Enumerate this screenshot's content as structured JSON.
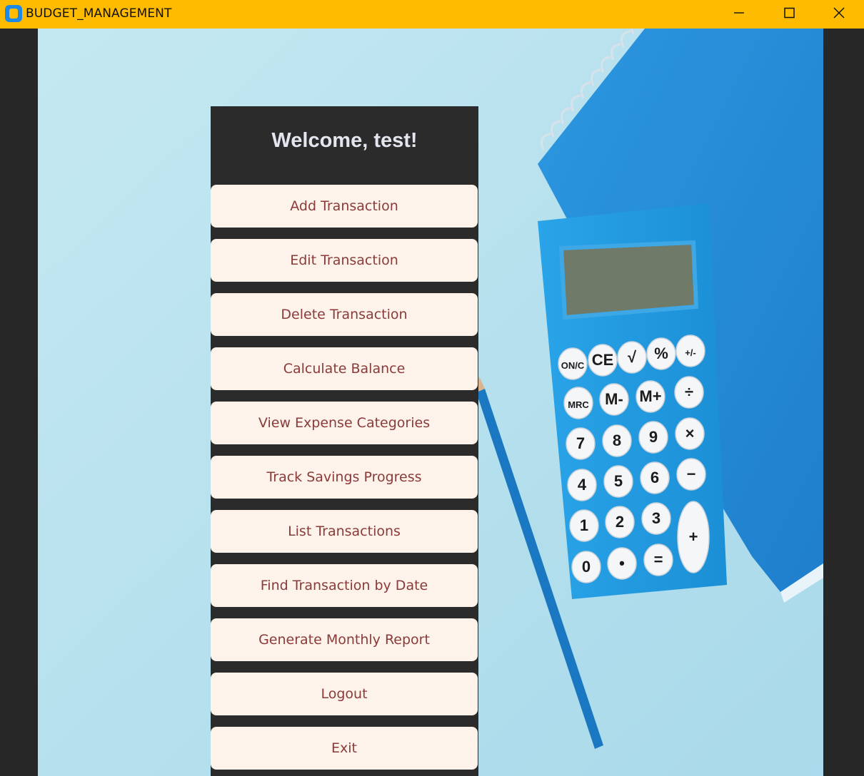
{
  "window": {
    "title": "BUDGET_MANAGEMENT"
  },
  "panel": {
    "welcome": "Welcome, test!",
    "buttons": [
      "Add Transaction",
      "Edit Transaction",
      "Delete Transaction",
      "Calculate Balance",
      "View Expense Categories",
      "Track Savings Progress",
      "List Transactions",
      "Find Transaction by Date",
      "Generate Monthly Report",
      "Logout",
      "Exit"
    ]
  },
  "background_image": {
    "calculator_keys": [
      "ON/C",
      "CE",
      "√",
      "%",
      "+/-",
      "MRC",
      "M-",
      "M+",
      "÷",
      "7",
      "8",
      "9",
      "×",
      "4",
      "5",
      "6",
      "−",
      "1",
      "2",
      "3",
      "+",
      "0",
      "•",
      "="
    ]
  },
  "colors": {
    "titlebar": "#ffbb00",
    "frame": "#272727",
    "panel": "#2b2b2b",
    "button_bg": "#fdf3ea",
    "button_text": "#8b3a3a",
    "welcome_text": "#e3e6ee",
    "background": "#b7e2ee"
  }
}
